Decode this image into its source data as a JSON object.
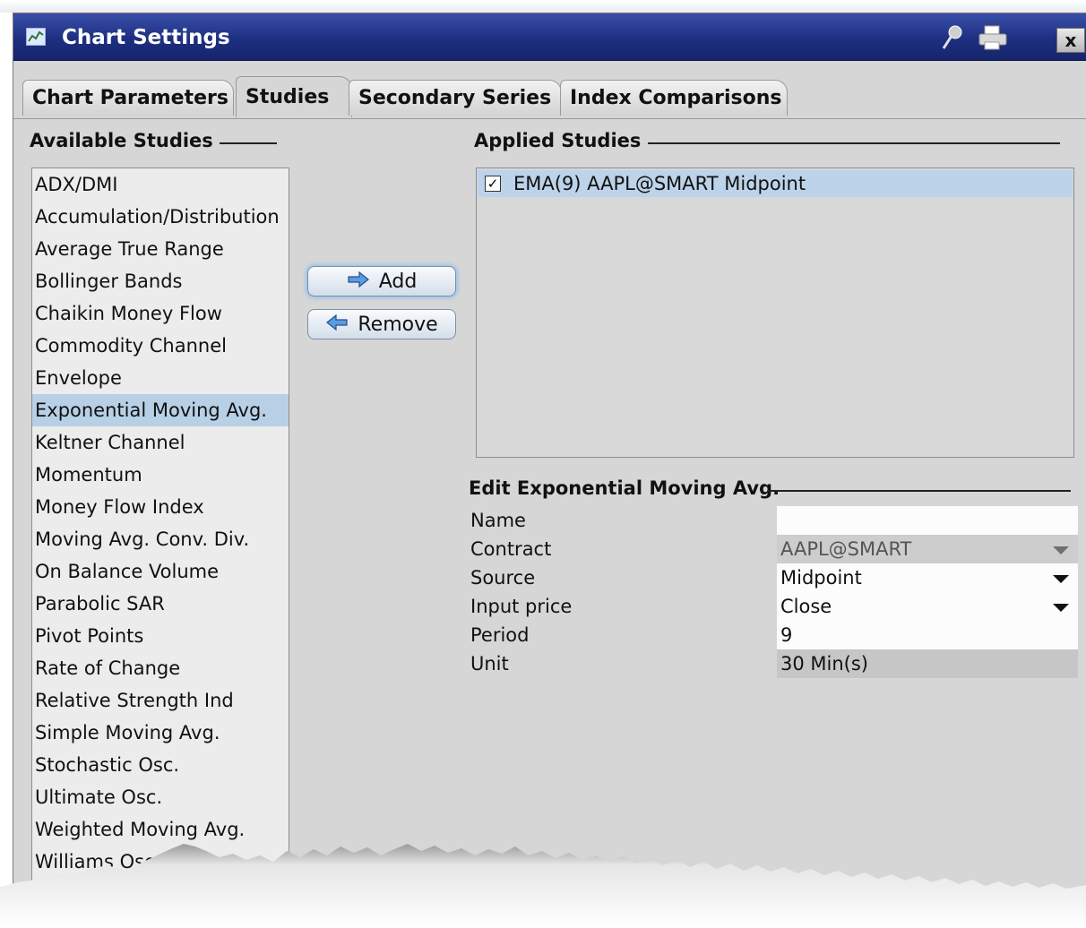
{
  "window": {
    "title": "Chart Settings",
    "icons": [
      "chart-icon",
      "pin-icon",
      "print-icon",
      "close-icon"
    ],
    "close_label": "x"
  },
  "tabs": [
    {
      "label": "Chart Parameters",
      "active": false
    },
    {
      "label": "Studies",
      "active": true
    },
    {
      "label": "Secondary Series",
      "active": false
    },
    {
      "label": "Index Comparisons",
      "active": false
    }
  ],
  "available": {
    "heading": "Available Studies",
    "items": [
      "ADX/DMI",
      "Accumulation/Distribution",
      "Average True Range",
      "Bollinger Bands",
      "Chaikin Money Flow",
      "Commodity Channel",
      "Envelope",
      "Exponential Moving Avg.",
      "Keltner Channel",
      "Momentum",
      "Money Flow Index",
      "Moving Avg. Conv. Div.",
      "On Balance Volume",
      "Parabolic SAR",
      "Pivot Points",
      "Rate of Change",
      "Relative Strength Ind",
      "Simple Moving Avg.",
      "Stochastic Osc.",
      "Ultimate Osc.",
      "Weighted Moving Avg.",
      "Williams Osc"
    ],
    "selected_index": 7
  },
  "buttons": {
    "add": "Add",
    "remove": "Remove"
  },
  "applied": {
    "heading": "Applied Studies",
    "items": [
      {
        "checked": true,
        "label": "EMA(9) AAPL@SMART Midpoint"
      }
    ]
  },
  "edit": {
    "heading": "Edit Exponential Moving Avg.",
    "fields": [
      {
        "label": "Name",
        "value": "",
        "dropdown": false
      },
      {
        "label": "Contract",
        "value": "AAPL@SMART",
        "dropdown": true
      },
      {
        "label": "Source",
        "value": "Midpoint",
        "dropdown": true
      },
      {
        "label": "Input price",
        "value": "Close",
        "dropdown": true
      },
      {
        "label": "Period",
        "value": "9",
        "dropdown": false
      },
      {
        "label": "Unit",
        "value": "30 Min(s)",
        "dropdown": false
      }
    ]
  },
  "colors": {
    "title_bar": "#1d2f82",
    "selected_row": "#b8d0e6",
    "window_bg": "#d6d6d6"
  }
}
